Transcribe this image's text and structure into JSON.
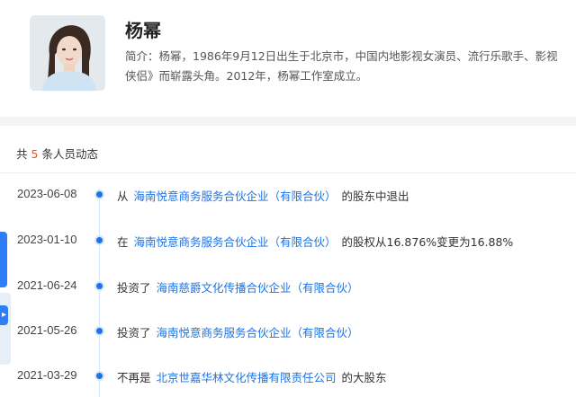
{
  "profile": {
    "name": "杨幂",
    "bio_line1": "简介：杨幂，1986年9月12日出生于北京市，中国内地影视女演员、流行乐歌手、影视",
    "bio_line2": "侠侣》而崭露头角。2012年，杨幂工作室成立。"
  },
  "dynamics": {
    "count_prefix": "共",
    "count_value": "5",
    "count_suffix": "条人员动态",
    "rows": [
      {
        "date": "2023-06-08",
        "pre": "从",
        "link": "海南悦意商务服务合伙企业（有限合伙）",
        "post": "的股东中退出"
      },
      {
        "date": "2023-01-10",
        "pre": "在",
        "link": "海南悦意商务服务合伙企业（有限合伙）",
        "post": "的股权从16.876%变更为16.88%"
      },
      {
        "date": "2021-06-24",
        "pre": "投资了",
        "link": "海南慈爵文化传播合伙企业（有限合伙）",
        "post": ""
      },
      {
        "date": "2021-05-26",
        "pre": "投资了",
        "link": "海南悦意商务服务合伙企业（有限合伙）",
        "post": ""
      },
      {
        "date": "2021-03-29",
        "pre": "不再是",
        "link": "北京世嘉华林文化传播有限责任公司",
        "post": "的大股东"
      }
    ]
  },
  "colors": {
    "accent": "#1a73e8",
    "count_highlight": "#e35b2c",
    "side_tab": "#2e7cf6"
  },
  "icons": {
    "avatar": "person-photo-avatar",
    "side_arrow": "chevron-right-icon"
  }
}
